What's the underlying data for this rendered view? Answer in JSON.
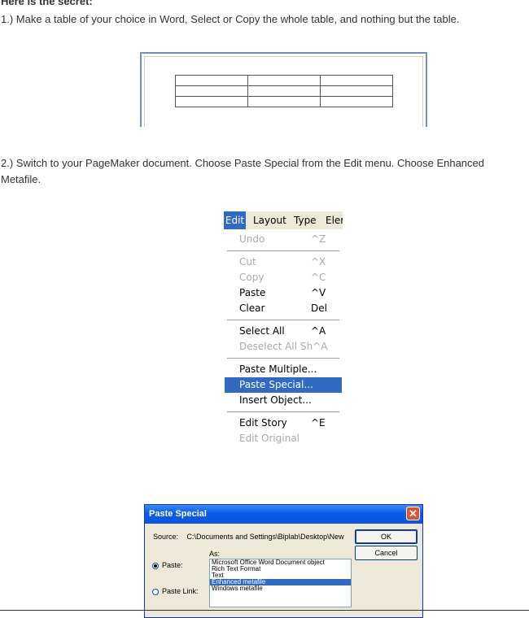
{
  "heading": "Here is the secret:",
  "step1": "1.) Make a table of your choice in Word, Select or Copy the whole table, and nothing but the table.",
  "step2_line1": "2.) Switch to your PageMaker document. Choose Paste Special from the Edit menu. Choose Enhanced",
  "step2_line2": "Metafile.",
  "edit_menu": {
    "menubar": [
      "Edit",
      "Layout",
      "Type",
      "Elem"
    ],
    "items": {
      "undo": {
        "label": "Undo",
        "shortcut": "^Z"
      },
      "cut": {
        "label": "Cut",
        "shortcut": "^X"
      },
      "copy": {
        "label": "Copy",
        "shortcut": "^C"
      },
      "paste": {
        "label": "Paste",
        "shortcut": "^V"
      },
      "clear": {
        "label": "Clear",
        "shortcut": "Del"
      },
      "select_all": {
        "label": "Select All",
        "shortcut": "^A"
      },
      "deselect_all": {
        "label": "Deselect All",
        "shortcut": "Sh^A"
      },
      "paste_multiple": {
        "label": "Paste Multiple..."
      },
      "paste_special": {
        "label": "Paste Special..."
      },
      "insert_object": {
        "label": "Insert Object..."
      },
      "edit_story": {
        "label": "Edit Story",
        "shortcut": "^E"
      },
      "edit_original": {
        "label": "Edit Original"
      }
    }
  },
  "dialog": {
    "title": "Paste Special",
    "source_label": "Source:",
    "source_value": "C:\\Documents and Settings\\Biplab\\Desktop\\New",
    "ok": "OK",
    "cancel": "Cancel",
    "as_label": "As:",
    "paste_label": "Paste:",
    "paste_link_label": "Paste Link:",
    "formats": [
      "Microsoft Office Word Document object",
      "Rich Text Format",
      "Text",
      "Enhanced metafile",
      "Windows metafile"
    ],
    "selected_format": "Enhanced metafile",
    "selected_option": "Paste:"
  },
  "colors": {
    "menu_highlight": "#316ac5",
    "titlebar": "#0a5ce8",
    "close_button": "#e0502f",
    "dialog_bg": "#ece9d8"
  }
}
